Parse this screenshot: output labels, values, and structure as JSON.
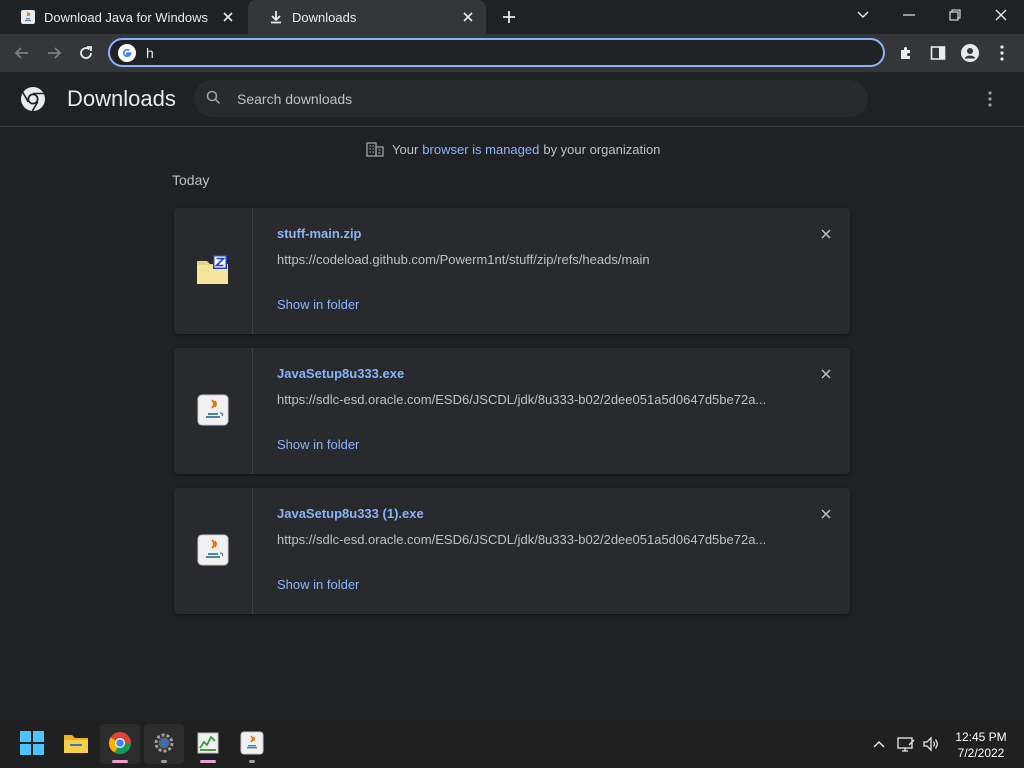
{
  "browser": {
    "tabs": [
      {
        "title": "Download Java for Windows",
        "icon": "java-icon"
      },
      {
        "title": "Downloads",
        "icon": "download-icon"
      }
    ],
    "address_value": "h"
  },
  "downloads": {
    "title": "Downloads",
    "search_placeholder": "Search downloads",
    "managed_notice": {
      "prefix": "Your",
      "link": "browser is managed",
      "suffix": "by your organization"
    },
    "date_label": "Today",
    "items": [
      {
        "file_name": "stuff-main.zip",
        "url": "https://codeload.github.com/Powerm1nt/stuff/zip/refs/heads/main",
        "action": "Show in folder",
        "icon": "zip-folder-icon"
      },
      {
        "file_name": "JavaSetup8u333.exe",
        "url": "https://sdlc-esd.oracle.com/ESD6/JSCDL/jdk/8u333-b02/2dee051a5d0647d5be72a...",
        "action": "Show in folder",
        "icon": "java-installer-icon"
      },
      {
        "file_name": "JavaSetup8u333 (1).exe",
        "url": "https://sdlc-esd.oracle.com/ESD6/JSCDL/jdk/8u333-b02/2dee051a5d0647d5be72a...",
        "action": "Show in folder",
        "icon": "java-installer-icon"
      }
    ]
  },
  "taskbar": {
    "time": "12:45 PM",
    "date": "7/2/2022"
  },
  "colors": {
    "accent": "#8ab4f8",
    "background": "#202124",
    "card": "#292a2d"
  }
}
